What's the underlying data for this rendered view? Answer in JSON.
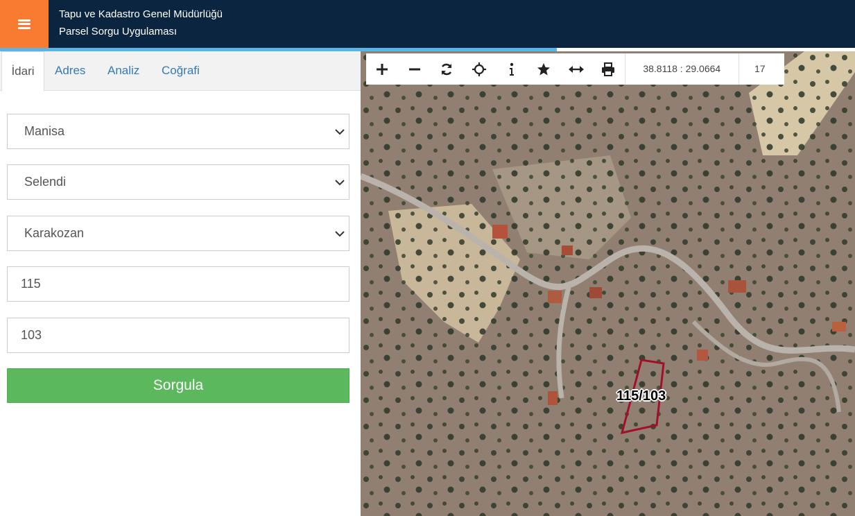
{
  "header": {
    "title_line1": "Tapu ve Kadastro Genel Müdürlüğü",
    "title_line2": "Parsel Sorgu Uygulaması",
    "menu_icon": "hamburger-icon",
    "accent_color": "#f97b2f",
    "bg_color": "#0b2540"
  },
  "tabs": [
    {
      "label": "İdari",
      "active": true
    },
    {
      "label": "Adres",
      "active": false
    },
    {
      "label": "Analiz",
      "active": false
    },
    {
      "label": "Coğrafi",
      "active": false
    }
  ],
  "form": {
    "il": "Manisa",
    "ilce": "Selendi",
    "mahalle": "Karakozan",
    "ada": "115",
    "parsel": "103",
    "submit_label": "Sorgula",
    "submit_color": "#5cb85c"
  },
  "map_toolbar": {
    "tools": [
      "zoom-in-icon",
      "zoom-out-icon",
      "refresh-icon",
      "locate-icon",
      "info-icon",
      "star-icon",
      "measure-icon",
      "print-icon"
    ],
    "coordinates": "38.8118 : 29.0664",
    "zoom": "17"
  },
  "map": {
    "parcel_label": "115/103",
    "parcel_color": "#a0102a"
  }
}
